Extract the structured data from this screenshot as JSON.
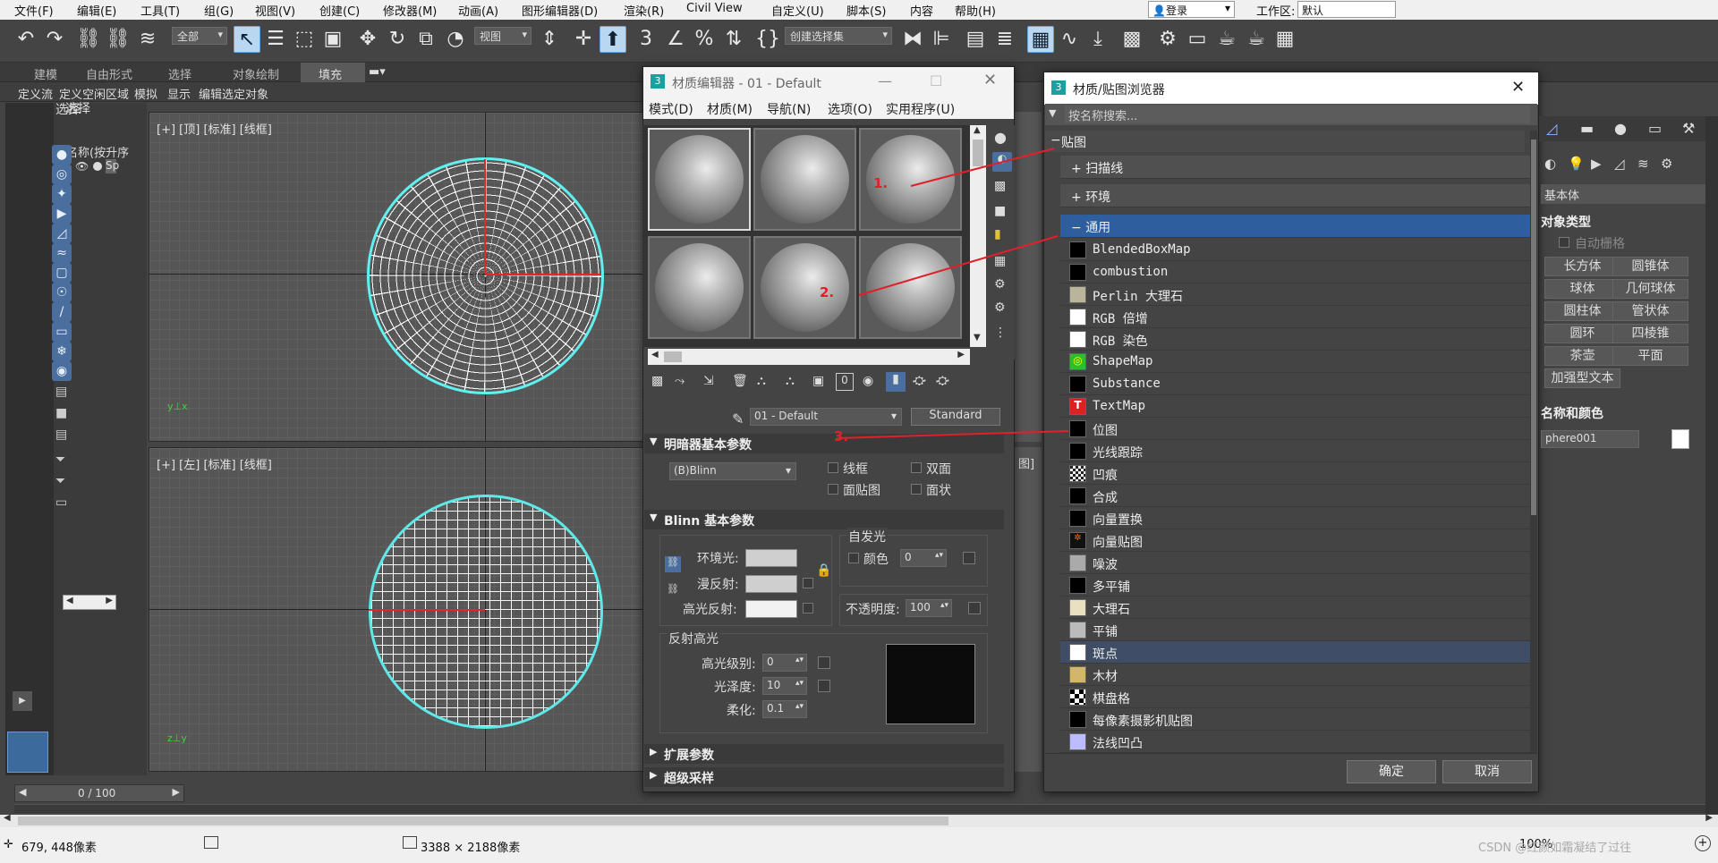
{
  "menubar": {
    "items": [
      "文件(F)",
      "编辑(E)",
      "工具(T)",
      "组(G)",
      "视图(V)",
      "创建(C)",
      "修改器(M)",
      "动画(A)",
      "图形编辑器(D)",
      "渲染(R)",
      "Civil View",
      "自定义(U)",
      "脚本(S)",
      "内容",
      "帮助(H)"
    ],
    "login": "登录",
    "workspace_label": "工作区:",
    "workspace_value": "默认"
  },
  "toolbar": {
    "filter_value": "全部",
    "view_value": "视图",
    "selection_set": "创建选择集"
  },
  "ribbon": {
    "tabs": [
      "建模",
      "自由形式",
      "选择",
      "对象绘制",
      "填充"
    ],
    "sub_tabs": [
      "定义流",
      "定义空闲区域",
      "模拟",
      "显示",
      "编辑选定对象"
    ]
  },
  "scene_explorer": {
    "select_label": "选择",
    "name_header": "名称(按升序",
    "row_text": "Sp"
  },
  "viewports": {
    "top_label": "[+] [顶] [标准] [线框]",
    "left_label": "[+] [左] [标准] [线框]",
    "right_fragment": "图]"
  },
  "timeline": {
    "frame": "0 / 100"
  },
  "material_editor": {
    "title": "材质编辑器 - 01 - Default",
    "menu": [
      "模式(D)",
      "材质(M)",
      "导航(N)",
      "选项(O)",
      "实用程序(U)"
    ],
    "material_name": "01 - Default",
    "material_type": "Standard",
    "rollouts": {
      "shader_basic": "明暗器基本参数",
      "shader_value": "(B)Blinn",
      "options": [
        "线框",
        "双面",
        "面贴图",
        "面状"
      ],
      "blinn_basic": "Blinn 基本参数",
      "ambient": "环境光:",
      "diffuse": "漫反射:",
      "specular": "高光反射:",
      "self_illum": "自发光",
      "color_label": "颜色",
      "color_value": "0",
      "opacity": "不透明度:",
      "opacity_value": "100",
      "spec_highlights": "反射高光",
      "spec_level": "高光级别:",
      "spec_level_value": "0",
      "gloss": "光泽度:",
      "gloss_value": "10",
      "soften": "柔化:",
      "soften_value": "0.1",
      "extended": "扩展参数",
      "supersampling": "超级采样"
    }
  },
  "annotations": [
    "1.",
    "2.",
    "3."
  ],
  "map_browser": {
    "title": "材质/贴图浏览器",
    "search_placeholder": "按名称搜索...",
    "root": "贴图",
    "categories": [
      "扫描线",
      "环境",
      "通用"
    ],
    "items": [
      "BlendedBoxMap",
      "combustion",
      "Perlin 大理石",
      "RGB 倍增",
      "RGB 染色",
      "ShapeMap",
      "Substance",
      "TextMap",
      "位图",
      "光线跟踪",
      "凹痕",
      "合成",
      "向量置换",
      "向量贴图",
      "噪波",
      "多平铺",
      "大理石",
      "平铺",
      "斑点",
      "木材",
      "棋盘格",
      "每像素摄影机贴图",
      "法线凹凸"
    ],
    "ok": "确定",
    "cancel": "取消"
  },
  "command_panel": {
    "geometry_type": "基本体",
    "object_type": "对象类型",
    "auto_grid": "自动栅格",
    "buttons": [
      "长方体",
      "圆锥体",
      "球体",
      "几何球体",
      "圆柱体",
      "管状体",
      "圆环",
      "四棱锥",
      "茶壶",
      "平面"
    ],
    "enhanced_text": "加强型文本",
    "name_color": "名称和颜色",
    "object_name": "phere001"
  },
  "statusbar": {
    "coords": "679, 448像素",
    "size": "3388 × 2188像素",
    "zoom": "100%",
    "watermark": "CSDN @红颜如霜凝结了过往"
  },
  "colors": {
    "accent": "#2f5e9e",
    "cyan": "#5ff0f0",
    "annotation_red": "#e0202a"
  }
}
